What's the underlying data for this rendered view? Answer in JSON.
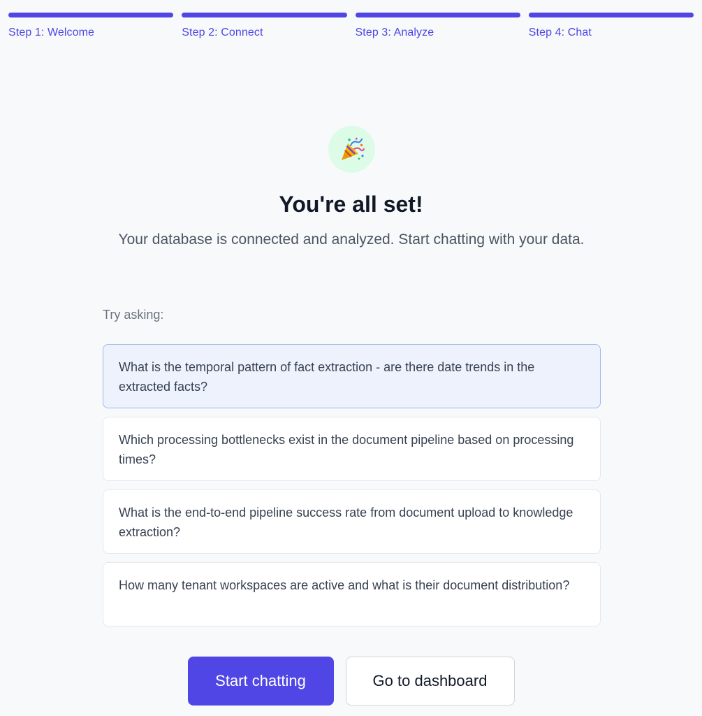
{
  "stepper": {
    "steps": [
      {
        "label": "Step 1: Welcome"
      },
      {
        "label": "Step 2: Connect"
      },
      {
        "label": "Step 3: Analyze"
      },
      {
        "label": "Step 4: Chat"
      }
    ],
    "accent_color": "#4f46e5"
  },
  "hero": {
    "icon": "party-popper-icon",
    "title": "You're all set!",
    "subtitle": "Your database is connected and analyzed. Start chatting with your data."
  },
  "suggestions": {
    "label": "Try asking:",
    "items": [
      {
        "text": "What is the temporal pattern of fact extraction - are there date trends in the extracted facts?"
      },
      {
        "text": "Which processing bottlenecks exist in the document pipeline based on processing times?"
      },
      {
        "text": "What is the end-to-end pipeline success rate from document upload to knowledge extraction?"
      },
      {
        "text": "How many tenant workspaces are active and what is their document distribution?"
      }
    ]
  },
  "actions": {
    "primary_label": "Start chatting",
    "secondary_label": "Go to dashboard"
  }
}
